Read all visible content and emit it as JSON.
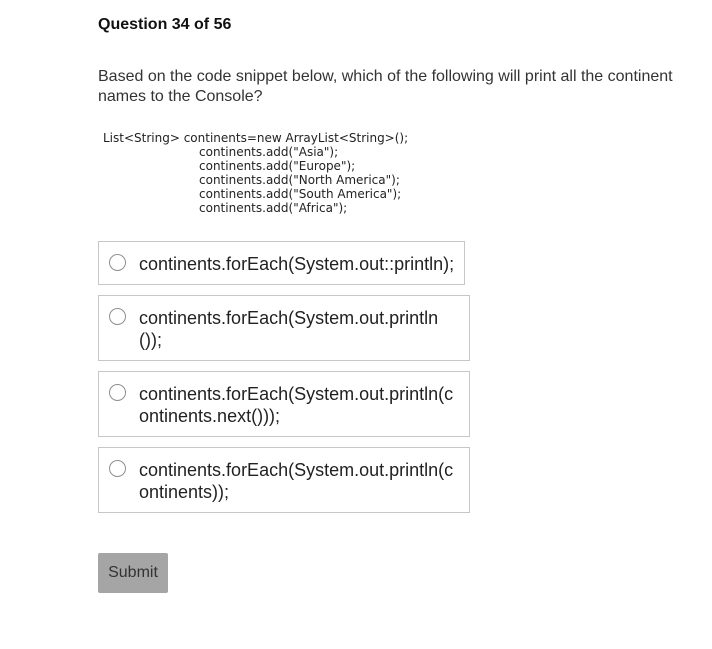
{
  "question": {
    "header": "Question 34 of 56",
    "prompt": "Based on the code snippet below, which of the following will print all the continent names to the Console?",
    "code_lines": [
      "List<String> continents=new ArrayList<String>();",
      "continents.add(\"Asia\");",
      "continents.add(\"Europe\");",
      "continents.add(\"North America\");",
      "continents.add(\"South America\");",
      "continents.add(\"Africa\");"
    ]
  },
  "options": [
    {
      "label": "continents.forEach(System.out::println);"
    },
    {
      "label": "continents.forEach(System.out.println());"
    },
    {
      "label": "continents.forEach(System.out.println(continents.next()));"
    },
    {
      "label": "continents.forEach(System.out.println(continents));"
    }
  ],
  "submit": {
    "label": "Submit",
    "color": "#a5a5a5"
  }
}
